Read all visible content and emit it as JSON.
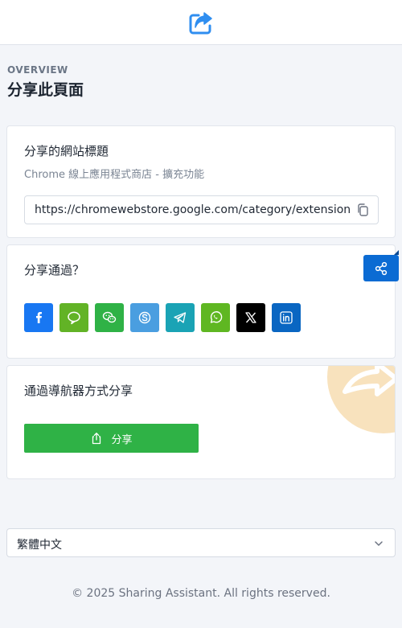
{
  "header": {
    "logo_icon": "share-forward-icon",
    "accent": "#2f8ef0"
  },
  "overview": {
    "eyebrow": "OVERVIEW",
    "title": "分享此頁面"
  },
  "page_info": {
    "heading": "分享的網站標題",
    "site_title": "Chrome 線上應用程式商店 - 擴充功能",
    "url": "https://chromewebstore.google.com/category/extensions?",
    "copy_icon": "copy-icon"
  },
  "share_via": {
    "heading": "分享通過？",
    "buttons": [
      {
        "name": "facebook",
        "icon": "facebook-icon",
        "color": "#1877f2"
      },
      {
        "name": "line",
        "icon": "line-icon",
        "color": "#62b326"
      },
      {
        "name": "wechat",
        "icon": "wechat-icon",
        "color": "#2fb246"
      },
      {
        "name": "skype",
        "icon": "skype-icon",
        "color": "#4a9ee0"
      },
      {
        "name": "telegram",
        "icon": "telegram-icon",
        "color": "#1aa3b5"
      },
      {
        "name": "whatsapp",
        "icon": "whatsapp-icon",
        "color": "#5fb722"
      },
      {
        "name": "x",
        "icon": "x-icon",
        "color": "#000000"
      },
      {
        "name": "linkedin",
        "icon": "linkedin-icon",
        "color": "#0a66c2"
      }
    ],
    "floating_button_icon": "share-nodes-icon",
    "floating_button_color": "#0b6bd3"
  },
  "native_share": {
    "heading": "通過導航器方式分享",
    "button_label": "分享",
    "button_icon": "upload-share-icon",
    "button_color": "#2fb246"
  },
  "language": {
    "selected": "繁體中文"
  },
  "footer": {
    "text": "© 2025 Sharing Assistant. All rights reserved."
  }
}
